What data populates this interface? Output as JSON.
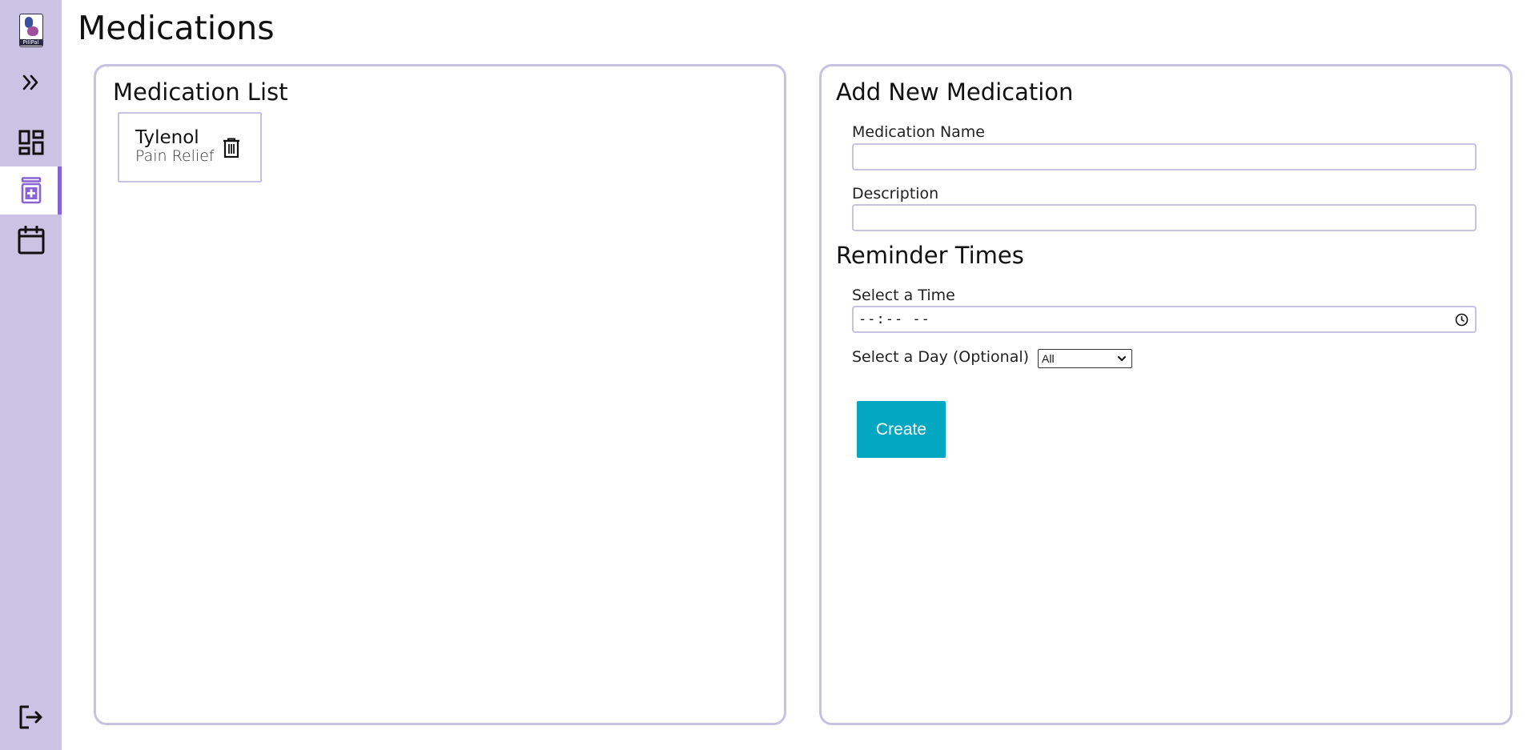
{
  "app": {
    "logo_text": "PillPal"
  },
  "sidebar": {
    "items": [
      {
        "icon": "expand-chevrons-icon"
      },
      {
        "icon": "dashboard-icon"
      },
      {
        "icon": "medication-icon",
        "active": true
      },
      {
        "icon": "calendar-icon"
      }
    ],
    "logout_icon": "logout-icon",
    "active_color": "#8a63d2",
    "background": "#cbc3e3"
  },
  "page": {
    "title": "Medications"
  },
  "medication_list": {
    "heading": "Medication List",
    "items": [
      {
        "name": "Tylenol",
        "description": "Pain Relief"
      }
    ]
  },
  "add_form": {
    "heading": "Add New Medication",
    "name_label": "Medication Name",
    "name_value": "",
    "description_label": "Description",
    "description_value": "",
    "reminder_heading": "Reminder Times",
    "time_label": "Select a Time",
    "time_value": "--:-- --",
    "day_label": "Select a Day (Optional)",
    "day_selected": "All",
    "create_label": "Create"
  },
  "colors": {
    "panel_border": "#c8c2e2",
    "create_button": "#03a7c1"
  }
}
